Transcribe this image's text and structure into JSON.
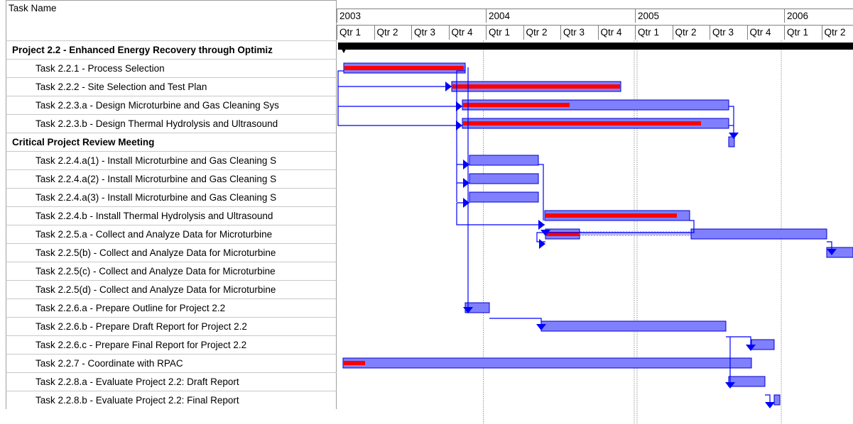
{
  "header": {
    "task_name_label": "Task Name"
  },
  "timescale": {
    "years": [
      "2003",
      "2004",
      "2005",
      "2006"
    ],
    "quarters": [
      "Qtr 1",
      "Qtr 2",
      "Qtr 3",
      "Qtr 4",
      "Qtr 1",
      "Qtr 2",
      "Qtr 3",
      "Qtr 4",
      "Qtr 1",
      "Qtr 2",
      "Qtr 3",
      "Qtr 4",
      "Qtr 1",
      "Qtr 2"
    ]
  },
  "colors": {
    "bar_fill": "#8080ff",
    "bar_border": "#0000cc",
    "progress": "#ff0000",
    "summary": "#000000",
    "link": "#0000ff",
    "gridline": "#b0b0b0"
  },
  "tasks": [
    {
      "name": "Project 2.2 - Enhanced Energy Recovery through Optimiz",
      "summary": true
    },
    {
      "name": "Task 2.2.1 - Process Selection"
    },
    {
      "name": "Task 2.2.2 - Site Selection and Test Plan"
    },
    {
      "name": "Task 2.2.3.a - Design Microturbine and Gas Cleaning Sys"
    },
    {
      "name": "Task 2.2.3.b - Design Thermal Hydrolysis and Ultrasound"
    },
    {
      "name": "Critical Project Review Meeting",
      "summary": true
    },
    {
      "name": "Task 2.2.4.a(1) - Install Microturbine and Gas Cleaning S"
    },
    {
      "name": "Task 2.2.4.a(2) - Install Microturbine and Gas Cleaning S"
    },
    {
      "name": "Task 2.2.4.a(3) - Install Microturbine and Gas Cleaning S"
    },
    {
      "name": "Task 2.2.4.b - Install Thermal Hydrolysis and Ultrasound"
    },
    {
      "name": "Task 2.2.5.a - Collect and Analyze Data for Microturbine"
    },
    {
      "name": "Task 2.2.5(b) - Collect and Analyze Data for Microturbine"
    },
    {
      "name": "Task 2.2.5(c) - Collect and Analyze Data for Microturbine"
    },
    {
      "name": "Task 2.2.5(d) - Collect and Analyze Data for Microturbine"
    },
    {
      "name": "Task 2.2.6.a - Prepare Outline for Project 2.2"
    },
    {
      "name": "Task 2.2.6.b - Prepare Draft Report for Project 2.2"
    },
    {
      "name": "Task 2.2.6.c - Prepare Final Report for Project 2.2"
    },
    {
      "name": "Task 2.2.7 - Coordinate with RPAC"
    },
    {
      "name": "Task 2.2.8.a - Evaluate Project 2.2:  Draft Report"
    },
    {
      "name": "Task 2.2.8.b - Evaluate Project 2.2:  Final Report"
    }
  ]
}
